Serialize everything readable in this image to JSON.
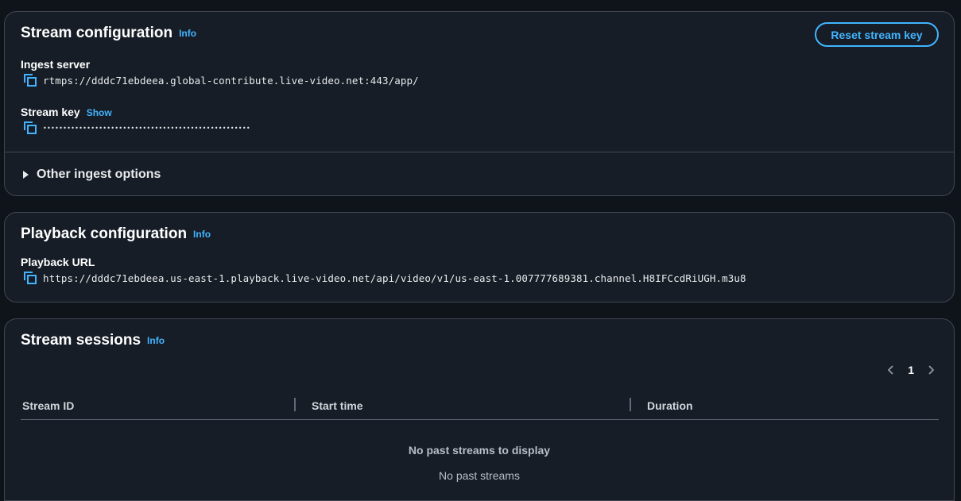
{
  "stream_configuration": {
    "title": "Stream configuration",
    "info_label": "Info",
    "reset_button_label": "Reset stream key",
    "ingest_server": {
      "label": "Ingest server",
      "value": "rtmps://dddc71ebdeea.global-contribute.live-video.net:443/app/"
    },
    "stream_key": {
      "label": "Stream key",
      "show_label": "Show",
      "masked_value": "••••••••••••••••••••••••••••••••••••••••••••••••••••"
    },
    "other_ingest_options_label": "Other ingest options"
  },
  "playback_configuration": {
    "title": "Playback configuration",
    "info_label": "Info",
    "playback_url": {
      "label": "Playback URL",
      "value": "https://dddc71ebdeea.us-east-1.playback.live-video.net/api/video/v1/us-east-1.007777689381.channel.H8IFCcdRiUGH.m3u8"
    }
  },
  "stream_sessions": {
    "title": "Stream sessions",
    "info_label": "Info",
    "pagination": {
      "current_page": "1"
    },
    "columns": [
      "Stream ID",
      "Start time",
      "Duration"
    ],
    "empty_title": "No past streams to display",
    "empty_subtitle": "No past streams"
  },
  "colors": {
    "background": "#0f141a",
    "panel": "#161d26",
    "border": "#424650",
    "accent": "#42b4ff",
    "text": "#e9ebed"
  },
  "icons": [
    "copy-icon",
    "caret-right-icon",
    "chevron-left-icon",
    "chevron-right-icon"
  ]
}
